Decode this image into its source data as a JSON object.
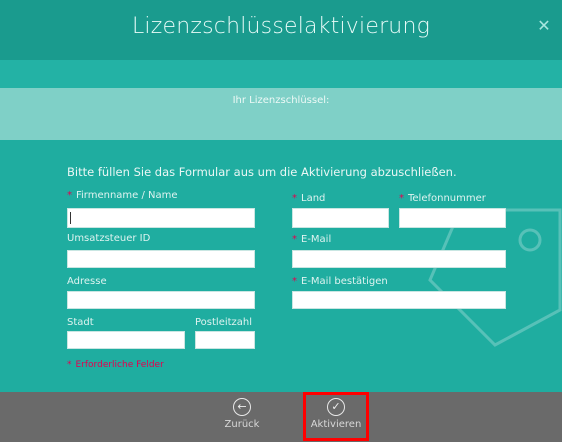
{
  "window": {
    "title": "Lizenzschlüsselaktivierung",
    "close_icon": "close-icon"
  },
  "license": {
    "label": "Ihr Lizenzschlüssel:"
  },
  "form": {
    "instruction": "Bitte füllen Sie das Formular aus um die Aktivierung abzuschließen.",
    "required_marker": "*",
    "fields": {
      "company": {
        "label": "Firmenname / Name",
        "value": "",
        "required": true
      },
      "vat": {
        "label": "Umsatzsteuer ID",
        "value": "",
        "required": false
      },
      "address": {
        "label": "Adresse",
        "value": "",
        "required": false
      },
      "city": {
        "label": "Stadt",
        "value": "",
        "required": false
      },
      "postal": {
        "label": "Postleitzahl",
        "value": "",
        "required": false
      },
      "country": {
        "label": "Land",
        "value": "",
        "required": true
      },
      "phone": {
        "label": "Telefonnummer",
        "value": "",
        "required": true
      },
      "email": {
        "label": "E-Mail",
        "value": "",
        "required": true
      },
      "email_confirm": {
        "label": "E-Mail bestätigen",
        "value": "",
        "required": true
      }
    },
    "footnote": "Erforderliche Felder"
  },
  "navigation": {
    "back_label": "Zurück",
    "back_icon": "arrow-left-icon",
    "activate_label": "Aktivieren",
    "activate_icon": "checkmark-icon"
  },
  "colors": {
    "accent": "#1fada0",
    "title_bar": "#1a9b8e",
    "license_box": "#7fd0c7",
    "required": "#e4004f",
    "bottom_bar": "#6a6a6a",
    "highlight": "#ff0000"
  }
}
